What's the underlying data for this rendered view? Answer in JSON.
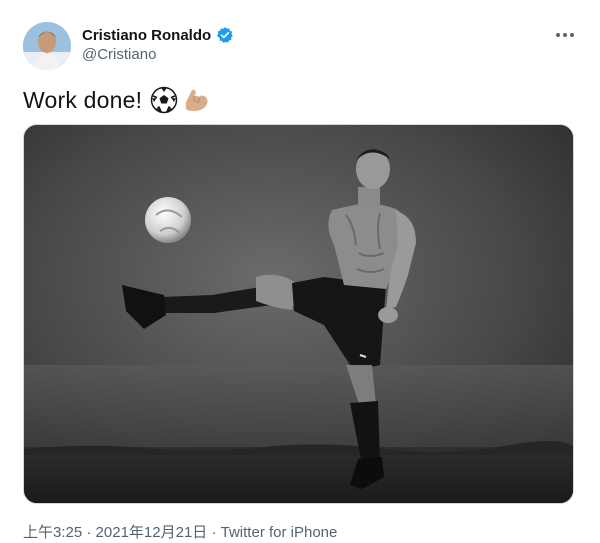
{
  "tweet": {
    "display_name": "Cristiano Ronaldo",
    "handle": "@Cristiano",
    "text": "Work done!",
    "emojis": [
      "soccer-ball-emoji",
      "flexed-biceps-emoji"
    ],
    "time": "上午3:25",
    "separator": " · ",
    "date": "2021年12月21日",
    "source": "Twitter for iPhone"
  },
  "colors": {
    "verified": "#1d9bf0",
    "text": "#0f1419",
    "secondary": "#536471"
  }
}
